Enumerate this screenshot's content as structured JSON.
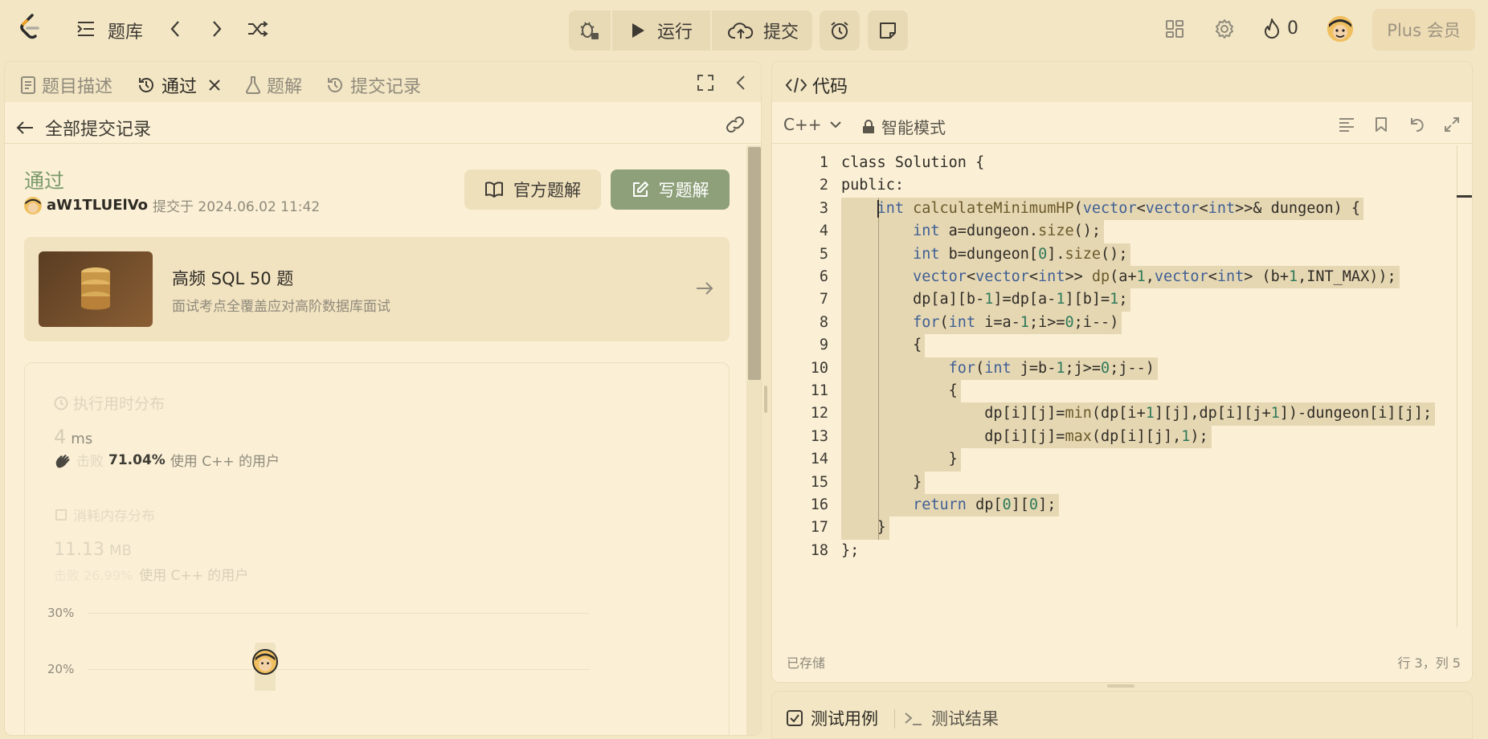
{
  "topbar": {
    "problem_bank_label": "题库",
    "run_label": "运行",
    "submit_label": "提交",
    "streak_count": "0",
    "plus_label": "Plus 会员"
  },
  "left_tabs": [
    {
      "label": "题目描述"
    },
    {
      "label": "通过"
    },
    {
      "label": "题解"
    },
    {
      "label": "提交记录"
    }
  ],
  "submissions": {
    "back_label": "全部提交记录",
    "status": "通过",
    "username": "aW1TLUElVo",
    "submitted_at": "提交于 2024.06.02 11:42",
    "official_solution_label": "官方题解",
    "write_solution_label": "写题解"
  },
  "promo": {
    "title": "高频 SQL 50 题",
    "subtitle": "面试考点全覆盖应对高阶数据库面试"
  },
  "stats": {
    "runtime_title": "执行用时分布",
    "runtime_value": "4",
    "runtime_unit": "ms",
    "runtime_beats_prefix": "击败",
    "runtime_beats_value": "71.04%",
    "runtime_beats_suffix": "使用 C++ 的用户",
    "memory_title": "消耗内存分布",
    "memory_value": "11.13",
    "memory_unit": "MB",
    "memory_beats_value": "击败 26.99%",
    "memory_beats_suffix": "使用 C++ 的用户",
    "chart_tick_30": "30%",
    "chart_tick_20": "20%"
  },
  "code_panel": {
    "title": "代码",
    "language": "C++",
    "mode": "智能模式",
    "saved_label": "已存储",
    "cursor_pos": "行 3，列 5"
  },
  "code_lines": [
    "class Solution {",
    "public:",
    "    int calculateMinimumHP(vector<vector<int>>& dungeon) {",
    "        int a=dungeon.size();",
    "        int b=dungeon[0].size();",
    "        vector<vector<int>> dp(a+1,vector<int> (b+1,INT_MAX));",
    "        dp[a][b-1]=dp[a-1][b]=1;",
    "        for(int i=a-1;i>=0;i--)",
    "        {",
    "            for(int j=b-1;j>=0;j--)",
    "            {",
    "                dp[i][j]=min(dp[i+1][j],dp[i][j+1])-dungeon[i][j];",
    "                dp[i][j]=max(dp[i][j],1);",
    "            }",
    "        }",
    "        return dp[0][0];",
    "    }",
    "};"
  ],
  "bottom_tabs": {
    "testcase_label": "测试用例",
    "result_label": "测试结果"
  }
}
